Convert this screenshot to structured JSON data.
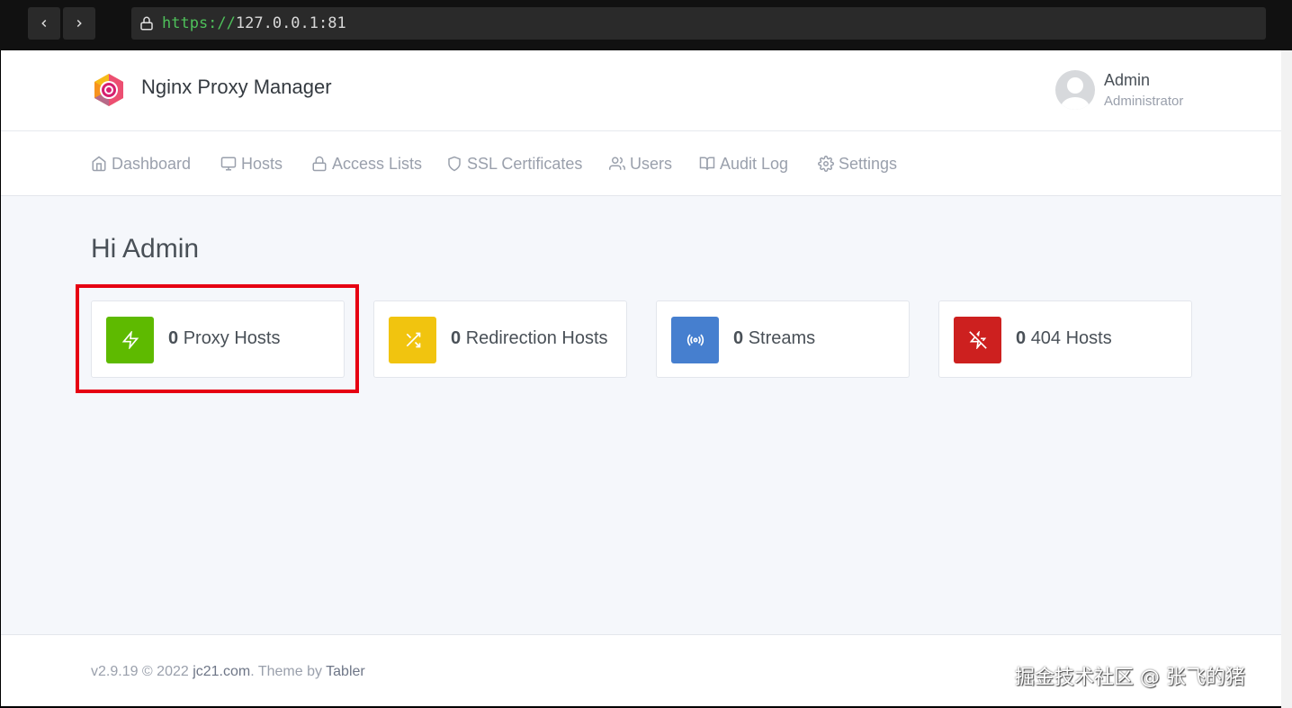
{
  "browser": {
    "url_scheme": "https://",
    "url_host": "127.0.0.1:81"
  },
  "header": {
    "brand": "Nginx Proxy Manager",
    "user": {
      "name": "Admin",
      "role": "Administrator"
    }
  },
  "nav": {
    "items": [
      {
        "label": "Dashboard",
        "icon": "home-icon"
      },
      {
        "label": "Hosts",
        "icon": "monitor-icon"
      },
      {
        "label": "Access Lists",
        "icon": "lock-icon"
      },
      {
        "label": "SSL Certificates",
        "icon": "shield-icon"
      },
      {
        "label": "Users",
        "icon": "users-icon"
      },
      {
        "label": "Audit Log",
        "icon": "book-open-icon"
      },
      {
        "label": "Settings",
        "icon": "settings-icon"
      }
    ]
  },
  "main": {
    "greeting": "Hi Admin",
    "cards": [
      {
        "count": "0",
        "label": "Proxy Hosts",
        "icon": "zap-icon",
        "color": "#5eba00"
      },
      {
        "count": "0",
        "label": "Redirection Hosts",
        "icon": "shuffle-icon",
        "color": "#f1c40f"
      },
      {
        "count": "0",
        "label": "Streams",
        "icon": "radio-icon",
        "color": "#467fcf"
      },
      {
        "count": "0",
        "label": "404 Hosts",
        "icon": "zap-off-icon",
        "color": "#cd201f"
      }
    ]
  },
  "footer": {
    "version": "v2.9.19 © 2022 ",
    "site_link": "jc21.com",
    "theme_prefix": ". Theme by ",
    "theme_link": "Tabler"
  },
  "watermark": "掘金技术社区 @ 张飞的猪",
  "colors": {
    "highlight": "#e60012"
  }
}
